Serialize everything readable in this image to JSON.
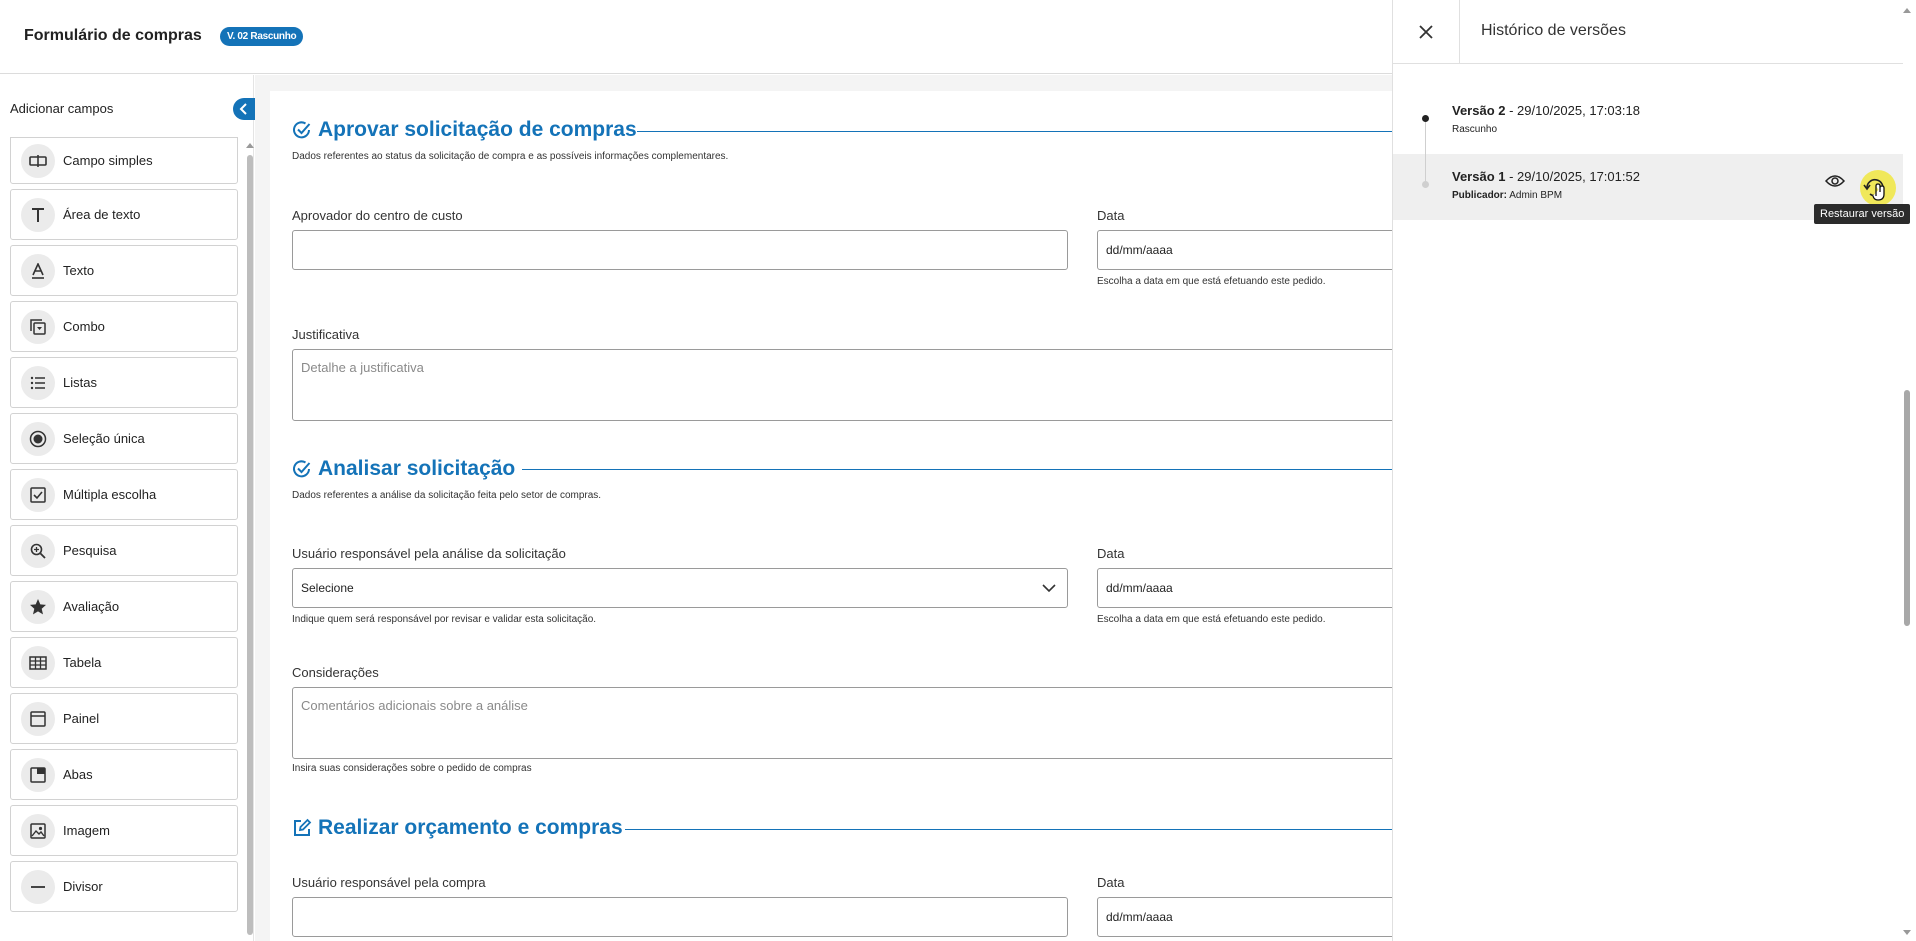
{
  "header": {
    "title": "Formulário de compras",
    "version_badge": "V. 02 Rascunho"
  },
  "sidebar": {
    "title": "Adicionar campos",
    "items": [
      {
        "label": "Campo simples",
        "icon": "input-field-icon"
      },
      {
        "label": "Área de texto",
        "icon": "text-area-icon"
      },
      {
        "label": "Texto",
        "icon": "text-icon"
      },
      {
        "label": "Combo",
        "icon": "dropdown-icon"
      },
      {
        "label": "Listas",
        "icon": "list-icon"
      },
      {
        "label": "Seleção única",
        "icon": "radio-icon"
      },
      {
        "label": "Múltipla escolha",
        "icon": "checkbox-icon"
      },
      {
        "label": "Pesquisa",
        "icon": "search-icon"
      },
      {
        "label": "Avaliação",
        "icon": "star-icon"
      },
      {
        "label": "Tabela",
        "icon": "table-icon"
      },
      {
        "label": "Painel",
        "icon": "panel-icon"
      },
      {
        "label": "Abas",
        "icon": "tabs-icon"
      },
      {
        "label": "Imagem",
        "icon": "image-icon"
      },
      {
        "label": "Divisor",
        "icon": "divider-icon"
      }
    ]
  },
  "form": {
    "section1": {
      "title": "Aprovar solicitação de compras",
      "description": "Dados referentes ao status da solicitação de compra e as possíveis informações complementares.",
      "approver_label": "Aprovador do centro de custo",
      "date_label": "Data",
      "date_placeholder": "dd/mm/aaaa",
      "date_hint": "Escolha a data em que está efetuando este pedido.",
      "justification_label": "Justificativa",
      "justification_placeholder": "Detalhe a justificativa"
    },
    "section2": {
      "title": "Analisar solicitação",
      "description": "Dados referentes a análise da solicitação feita pelo setor de compras.",
      "user_label": "Usuário responsável pela análise da solicitação",
      "user_select_value": "Selecione",
      "user_hint": "Indique quem será responsável por revisar e validar esta solicitação.",
      "date_label": "Data",
      "date_placeholder": "dd/mm/aaaa",
      "date_hint": "Escolha a data em que está efetuando este pedido.",
      "considerations_label": "Considerações",
      "considerations_placeholder": "Comentários adicionais sobre a análise",
      "considerations_hint": "Insira suas considerações sobre o pedido de compras"
    },
    "section3": {
      "title": "Realizar orçamento e compras",
      "user_label": "Usuário responsável pela compra",
      "date_label": "Data",
      "date_placeholder": "dd/mm/aaaa"
    }
  },
  "history": {
    "title": "Histórico de versões",
    "versions": [
      {
        "name": "Versão 2",
        "datetime": " - 29/10/2025, 17:03:18",
        "subtitle": "Rascunho"
      },
      {
        "name": "Versão 1",
        "datetime": " - 29/10/2025, 17:01:52",
        "subtitle_label": "Publicador:",
        "subtitle_value": " Admin BPM"
      }
    ],
    "restore_tooltip": "Restaurar versão"
  },
  "colors": {
    "accent": "#1473b8",
    "highlight": "#f0e628"
  }
}
